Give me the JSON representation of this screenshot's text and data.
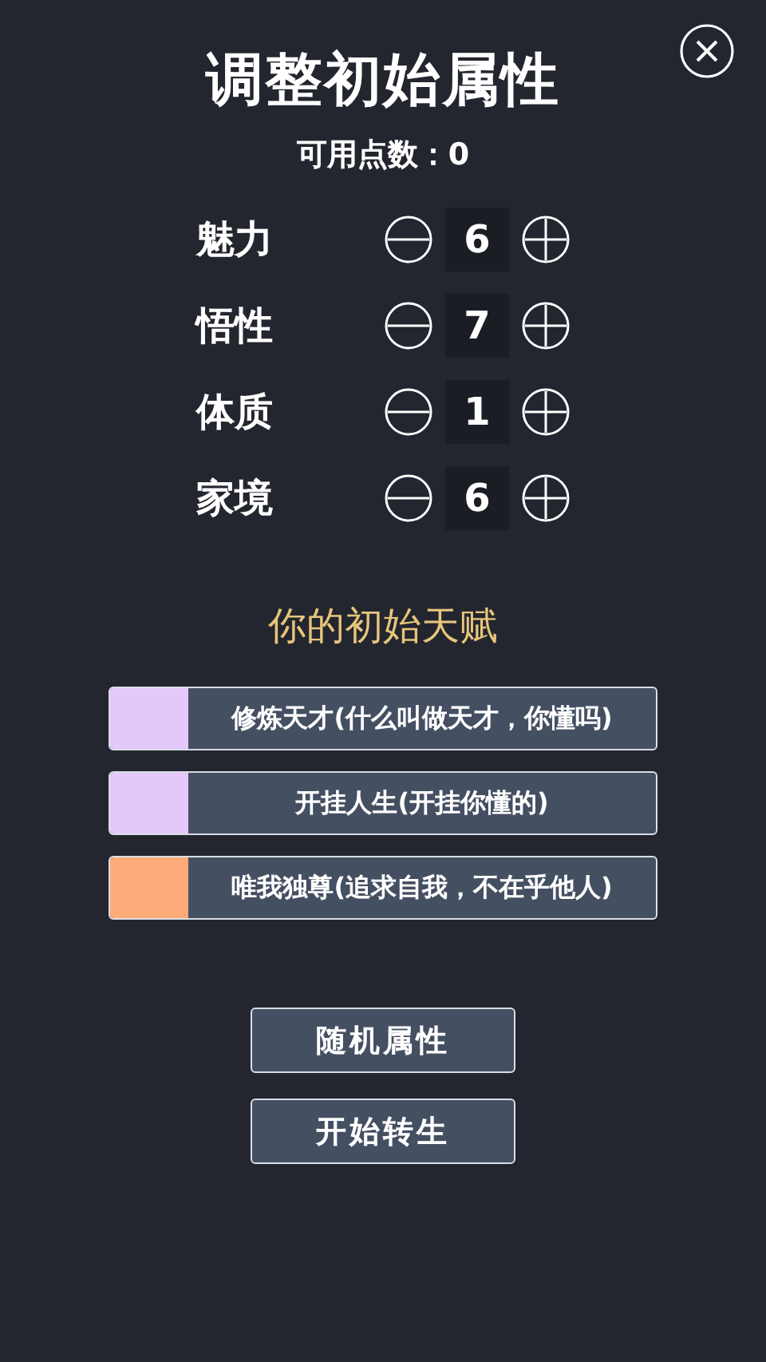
{
  "title": "调整初始属性",
  "points": "可用点数：0",
  "attributes": [
    {
      "name": "魅力",
      "value": "6"
    },
    {
      "name": "悟性",
      "value": "7"
    },
    {
      "name": "体质",
      "value": "1"
    },
    {
      "name": "家境",
      "value": "6"
    }
  ],
  "talents_heading": "你的初始天赋",
  "talents": [
    {
      "label": "修炼天才(什么叫做天才，你懂吗)",
      "color": "#e5c8fb"
    },
    {
      "label": "开挂人生(开挂你懂的)",
      "color": "#e5c8fb"
    },
    {
      "label": "唯我独尊(追求自我，不在乎他人)",
      "color": "#fdab78"
    }
  ],
  "buttons": [
    "随机属性",
    "开始转生"
  ]
}
